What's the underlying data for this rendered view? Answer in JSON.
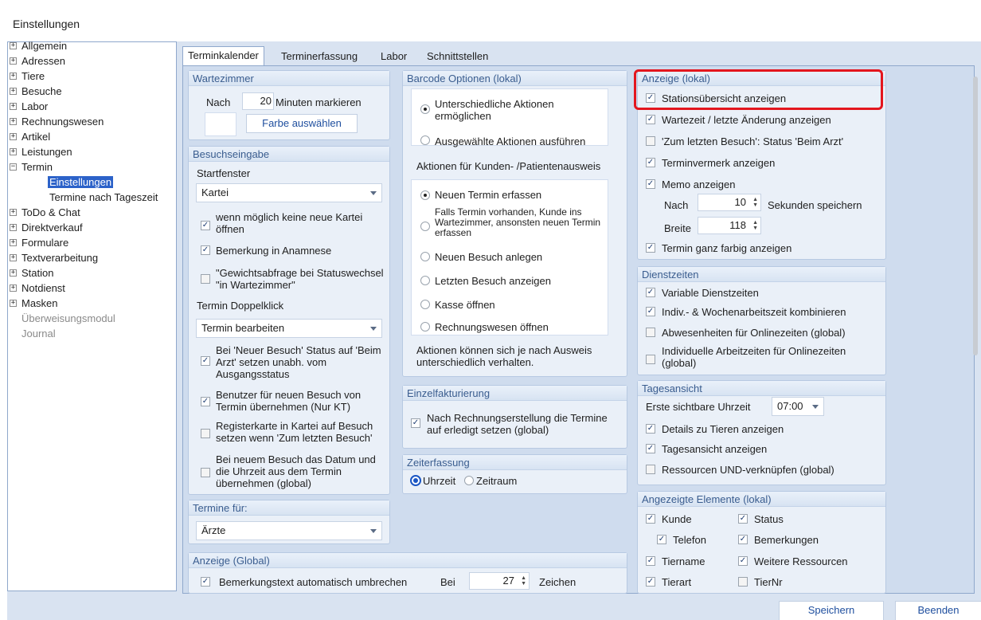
{
  "window": {
    "title": "Einstellungen"
  },
  "tree": {
    "items": [
      "Allgemein",
      "Adressen",
      "Tiere",
      "Besuche",
      "Labor",
      "Rechnungswesen",
      "Artikel",
      "Leistungen",
      "Termin",
      "Einstellungen",
      "Termine nach Tageszeit",
      "ToDo & Chat",
      "Direktverkauf",
      "Formulare",
      "Textverarbeitung",
      "Station",
      "Notdienst",
      "Masken",
      "Überweisungsmodul",
      "Journal"
    ],
    "selected": "Einstellungen"
  },
  "tabs": [
    "Terminkalender",
    "Terminerfassung",
    "Labor",
    "Schnittstellen"
  ],
  "wartezimmer": {
    "title": "Wartezimmer",
    "nach": "Nach",
    "minutes": "20",
    "suffix": "Minuten markieren",
    "color_button": "Farbe auswählen"
  },
  "besuchseingabe": {
    "title": "Besuchseingabe",
    "startfenster_label": "Startfenster",
    "startfenster_value": "Kartei",
    "cb1": "wenn möglich keine neue Kartei öffnen",
    "cb2": "Bemerkung in Anamnese",
    "cb3": "\"Gewichtsabfrage bei Statuswechsel \"in Wartezimmer\"",
    "doppelklick_label": "Termin Doppelklick",
    "doppelklick_value": "Termin bearbeiten",
    "cb4": "Bei 'Neuer Besuch' Status auf 'Beim Arzt' setzen unabh. vom Ausgangsstatus",
    "cb5": "Benutzer für neuen Besuch von Termin übernehmen (Nur KT)",
    "cb6": "Registerkarte in Kartei auf Besuch setzen wenn 'Zum letzten Besuch'",
    "cb7": "Bei neuem Besuch das Datum und die Uhrzeit aus dem Termin übernehmen (global)"
  },
  "termine_fuer": {
    "title": "Termine für:",
    "value": "Ärzte"
  },
  "anzeige_global": {
    "title": "Anzeige (Global)",
    "cb": "Bemerkungstext automatisch umbrechen",
    "bei": "Bei",
    "value": "27",
    "suffix": "Zeichen"
  },
  "barcode": {
    "title": "Barcode Optionen (lokal)",
    "r1": "Unterschiedliche Aktionen ermöglichen",
    "r2": "Ausgewählte Aktionen ausführen",
    "aktionen_title": "Aktionen für Kunden- /Patientenausweis",
    "a1": "Neuen Termin erfassen",
    "a2": "Falls Termin vorhanden, Kunde ins Wartezimmer, ansonsten neuen Termin erfassen",
    "a3": "Neuen Besuch anlegen",
    "a4": "Letzten Besuch anzeigen",
    "a5": "Kasse öffnen",
    "a6": "Rechnungswesen öffnen",
    "note": "Aktionen können sich je nach Ausweis unterschiedlich verhalten."
  },
  "einzel": {
    "title": "Einzelfakturierung",
    "cb": "Nach Rechnungserstellung die Termine auf erledigt setzen (global)"
  },
  "zeit": {
    "title": "Zeiterfassung",
    "r1": "Uhrzeit",
    "r2": "Zeitraum"
  },
  "anzeige_lokal": {
    "title": "Anzeige (lokal)",
    "cb1": "Stationsübersicht anzeigen",
    "cb2": "Wartezeit / letzte Änderung anzeigen",
    "cb3": "'Zum letzten Besuch': Status 'Beim Arzt'",
    "cb4": "Terminvermerk anzeigen",
    "cb5": "Memo anzeigen",
    "nach": "Nach",
    "nach_value": "10",
    "sek": "Sekunden speichern",
    "breite": "Breite",
    "breite_value": "118",
    "cb6": "Termin ganz farbig anzeigen"
  },
  "dienst": {
    "title": "Dienstzeiten",
    "cb1": "Variable Dienstzeiten",
    "cb2": "Indiv.- & Wochenarbeitszeit kombinieren",
    "cb3": "Abwesenheiten für Onlinezeiten (global)",
    "cb4": "Individuelle Arbeitzeiten für Onlinezeiten (global)"
  },
  "tag": {
    "title": "Tagesansicht",
    "erste": "Erste sichtbare Uhrzeit",
    "erste_value": "07:00",
    "cb1": "Details zu Tieren anzeigen",
    "cb2": "Tagesansicht anzeigen",
    "cb3": "Ressourcen UND-verknüpfen (global)"
  },
  "elemente": {
    "title": "Angezeigte Elemente (lokal)",
    "kunde": "Kunde",
    "status": "Status",
    "telefon": "Telefon",
    "bemerkungen": "Bemerkungen",
    "tiername": "Tiername",
    "weitere": "Weitere Ressourcen",
    "tierart": "Tierart",
    "tiernr": "TierNr"
  },
  "buttons": {
    "save": "Speichern",
    "close": "Beenden"
  },
  "icons": {
    "check": "✓",
    "plus": "+",
    "minus": "−"
  }
}
